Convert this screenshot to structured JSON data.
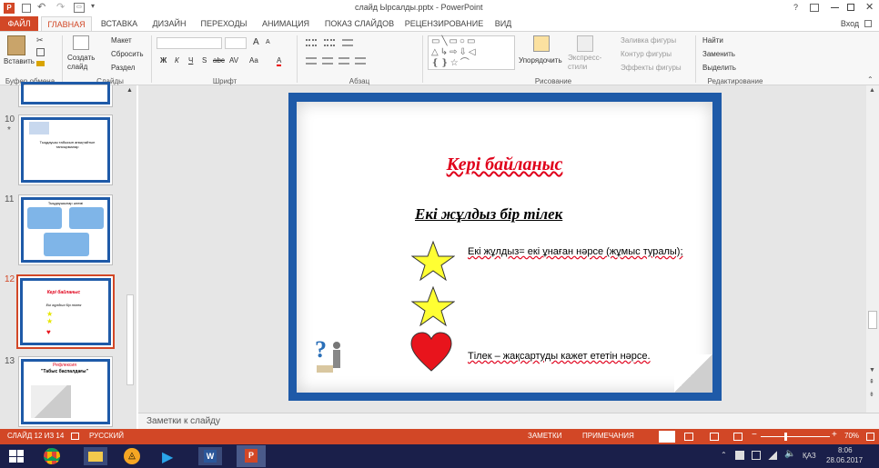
{
  "window": {
    "title": "слайд Ырсалды.pptx - PowerPoint",
    "help": "?",
    "login": "Вход"
  },
  "tabs": [
    {
      "label": "ФАЙЛ",
      "active": false,
      "file": true
    },
    {
      "label": "ГЛАВНАЯ",
      "active": true
    },
    {
      "label": "ВСТАВКА"
    },
    {
      "label": "ДИЗАЙН"
    },
    {
      "label": "ПЕРЕХОДЫ"
    },
    {
      "label": "АНИМАЦИЯ"
    },
    {
      "label": "ПОКАЗ СЛАЙДОВ"
    },
    {
      "label": "РЕЦЕНЗИРОВАНИЕ"
    },
    {
      "label": "ВИД"
    }
  ],
  "ribbon": {
    "clipboard": {
      "label": "Буфер обмена",
      "paste": "Вставить"
    },
    "slides": {
      "label": "Слайды",
      "create": "Создать слайд",
      "layout": "Макет",
      "reset": "Сбросить",
      "section": "Раздел"
    },
    "font": {
      "label": "Шрифт",
      "bold": "Ж",
      "italic": "К",
      "underline": "Ч",
      "strike": "S",
      "abc": "abc",
      "spacing": "AV",
      "case": "Aa",
      "color": "A",
      "grow": "A",
      "shrink": "A"
    },
    "paragraph": {
      "label": "Абзац"
    },
    "drawing": {
      "label": "Рисование",
      "arrange": "Упорядочить",
      "quick": "Экспресс-стили",
      "fill": "Заливка фигуры",
      "outline": "Контур фигуры",
      "effects": "Эффекты фигуры"
    },
    "editing": {
      "label": "Редактирование",
      "find": "Найти",
      "replace": "Заменить",
      "select": "Выделить"
    }
  },
  "thumbnails": [
    {
      "num": "10",
      "star": "*",
      "text": "Тыңдаушы табысын анықтайтын тапсырмалар"
    },
    {
      "num": "11",
      "text": "Тыңдаушылар әлемі"
    },
    {
      "num": "12",
      "title": "Кері байланыс",
      "sub": "Екі жұлдыз бір тілек",
      "active": true
    },
    {
      "num": "13",
      "title": "Рефлексия",
      "sub": "\"Табыс баспалдағы\""
    }
  ],
  "slide": {
    "title": "Кері байланыс",
    "subtitle": "Екі жұлдыз бір тілек",
    "item1": "Екі жұлдыз= екі ұнаған нәрсе (жұмыс туралы);",
    "item2": "Тілек – жақсартуды кажет ететін нәрсе."
  },
  "notes": "Заметки к слайду",
  "status": {
    "slide_info": "СЛАЙД 12 ИЗ 14",
    "lang": "РУССКИЙ",
    "notes_btn": "ЗАМЕТКИ",
    "comments_btn": "ПРИМЕЧАНИЯ",
    "zoom": "70%",
    "zoom_level": 0.7
  },
  "taskbar": {
    "lang": "ҚАЗ",
    "time": "8:06",
    "date": "28.06.2017"
  },
  "colors": {
    "accent": "#d24726",
    "slide_border": "#1e5aa8",
    "title_red": "#e0001a",
    "star": "#ffff33",
    "heart": "#e8141c"
  }
}
